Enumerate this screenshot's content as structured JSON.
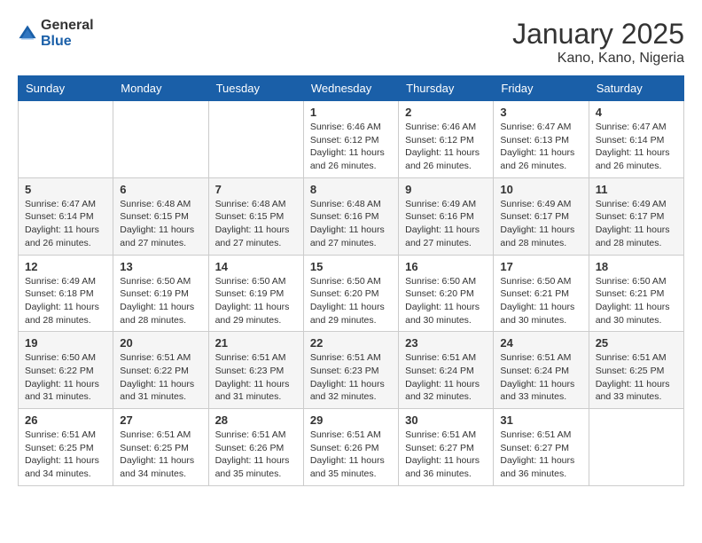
{
  "header": {
    "logo_general": "General",
    "logo_blue": "Blue",
    "month": "January 2025",
    "location": "Kano, Kano, Nigeria"
  },
  "weekdays": [
    "Sunday",
    "Monday",
    "Tuesday",
    "Wednesday",
    "Thursday",
    "Friday",
    "Saturday"
  ],
  "weeks": [
    [
      {
        "day": "",
        "info": ""
      },
      {
        "day": "",
        "info": ""
      },
      {
        "day": "",
        "info": ""
      },
      {
        "day": "1",
        "info": "Sunrise: 6:46 AM\nSunset: 6:12 PM\nDaylight: 11 hours and 26 minutes."
      },
      {
        "day": "2",
        "info": "Sunrise: 6:46 AM\nSunset: 6:12 PM\nDaylight: 11 hours and 26 minutes."
      },
      {
        "day": "3",
        "info": "Sunrise: 6:47 AM\nSunset: 6:13 PM\nDaylight: 11 hours and 26 minutes."
      },
      {
        "day": "4",
        "info": "Sunrise: 6:47 AM\nSunset: 6:14 PM\nDaylight: 11 hours and 26 minutes."
      }
    ],
    [
      {
        "day": "5",
        "info": "Sunrise: 6:47 AM\nSunset: 6:14 PM\nDaylight: 11 hours and 26 minutes."
      },
      {
        "day": "6",
        "info": "Sunrise: 6:48 AM\nSunset: 6:15 PM\nDaylight: 11 hours and 27 minutes."
      },
      {
        "day": "7",
        "info": "Sunrise: 6:48 AM\nSunset: 6:15 PM\nDaylight: 11 hours and 27 minutes."
      },
      {
        "day": "8",
        "info": "Sunrise: 6:48 AM\nSunset: 6:16 PM\nDaylight: 11 hours and 27 minutes."
      },
      {
        "day": "9",
        "info": "Sunrise: 6:49 AM\nSunset: 6:16 PM\nDaylight: 11 hours and 27 minutes."
      },
      {
        "day": "10",
        "info": "Sunrise: 6:49 AM\nSunset: 6:17 PM\nDaylight: 11 hours and 28 minutes."
      },
      {
        "day": "11",
        "info": "Sunrise: 6:49 AM\nSunset: 6:17 PM\nDaylight: 11 hours and 28 minutes."
      }
    ],
    [
      {
        "day": "12",
        "info": "Sunrise: 6:49 AM\nSunset: 6:18 PM\nDaylight: 11 hours and 28 minutes."
      },
      {
        "day": "13",
        "info": "Sunrise: 6:50 AM\nSunset: 6:19 PM\nDaylight: 11 hours and 28 minutes."
      },
      {
        "day": "14",
        "info": "Sunrise: 6:50 AM\nSunset: 6:19 PM\nDaylight: 11 hours and 29 minutes."
      },
      {
        "day": "15",
        "info": "Sunrise: 6:50 AM\nSunset: 6:20 PM\nDaylight: 11 hours and 29 minutes."
      },
      {
        "day": "16",
        "info": "Sunrise: 6:50 AM\nSunset: 6:20 PM\nDaylight: 11 hours and 30 minutes."
      },
      {
        "day": "17",
        "info": "Sunrise: 6:50 AM\nSunset: 6:21 PM\nDaylight: 11 hours and 30 minutes."
      },
      {
        "day": "18",
        "info": "Sunrise: 6:50 AM\nSunset: 6:21 PM\nDaylight: 11 hours and 30 minutes."
      }
    ],
    [
      {
        "day": "19",
        "info": "Sunrise: 6:50 AM\nSunset: 6:22 PM\nDaylight: 11 hours and 31 minutes."
      },
      {
        "day": "20",
        "info": "Sunrise: 6:51 AM\nSunset: 6:22 PM\nDaylight: 11 hours and 31 minutes."
      },
      {
        "day": "21",
        "info": "Sunrise: 6:51 AM\nSunset: 6:23 PM\nDaylight: 11 hours and 31 minutes."
      },
      {
        "day": "22",
        "info": "Sunrise: 6:51 AM\nSunset: 6:23 PM\nDaylight: 11 hours and 32 minutes."
      },
      {
        "day": "23",
        "info": "Sunrise: 6:51 AM\nSunset: 6:24 PM\nDaylight: 11 hours and 32 minutes."
      },
      {
        "day": "24",
        "info": "Sunrise: 6:51 AM\nSunset: 6:24 PM\nDaylight: 11 hours and 33 minutes."
      },
      {
        "day": "25",
        "info": "Sunrise: 6:51 AM\nSunset: 6:25 PM\nDaylight: 11 hours and 33 minutes."
      }
    ],
    [
      {
        "day": "26",
        "info": "Sunrise: 6:51 AM\nSunset: 6:25 PM\nDaylight: 11 hours and 34 minutes."
      },
      {
        "day": "27",
        "info": "Sunrise: 6:51 AM\nSunset: 6:25 PM\nDaylight: 11 hours and 34 minutes."
      },
      {
        "day": "28",
        "info": "Sunrise: 6:51 AM\nSunset: 6:26 PM\nDaylight: 11 hours and 35 minutes."
      },
      {
        "day": "29",
        "info": "Sunrise: 6:51 AM\nSunset: 6:26 PM\nDaylight: 11 hours and 35 minutes."
      },
      {
        "day": "30",
        "info": "Sunrise: 6:51 AM\nSunset: 6:27 PM\nDaylight: 11 hours and 36 minutes."
      },
      {
        "day": "31",
        "info": "Sunrise: 6:51 AM\nSunset: 6:27 PM\nDaylight: 11 hours and 36 minutes."
      },
      {
        "day": "",
        "info": ""
      }
    ]
  ]
}
